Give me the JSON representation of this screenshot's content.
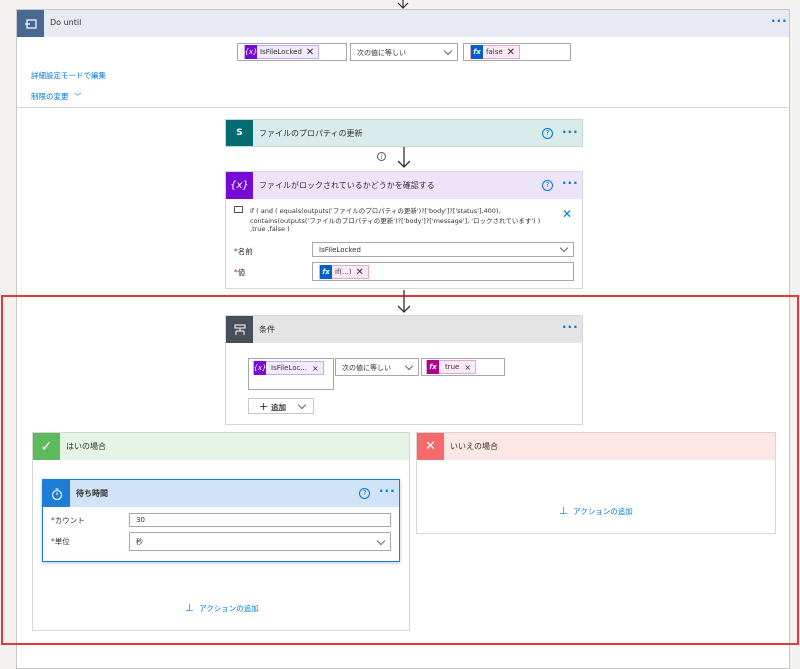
{
  "do_until": {
    "title": "Do until",
    "condition_left": "IsFileLocked",
    "condition_op": "次の値に等しい",
    "condition_right": "false",
    "advanced_link": "詳細設定モードで編集",
    "limits_link": "制限の変更"
  },
  "update_props": {
    "title": "ファイルのプロパティの更新"
  },
  "check_lock": {
    "title": "ファイルがロックされているかどうかを確認する",
    "expression_line1": "if ( and ( equals(outputs('ファイルのプロパティの更新')?['body']?['status'],400),",
    "expression_line2": "contains(outputs('ファイルのプロパティの更新')?['body']?['message'], 'ロックされています') )",
    "expression_line3": ",true ,false )",
    "name_label": "名前",
    "name_value": "IsFileLocked",
    "value_label": "値",
    "value_token": "if(...)"
  },
  "condition": {
    "title": "条件",
    "left_token": "IsFileLoc...",
    "op": "次の値に等しい",
    "right_token": "true",
    "add_label": "追加"
  },
  "yes_branch": {
    "title": "はいの場合",
    "add_action": "アクションの追加"
  },
  "no_branch": {
    "title": "いいえの場合",
    "add_action": "アクションの追加"
  },
  "wait": {
    "title": "待ち時間",
    "count_label": "カウント",
    "count_value": "30",
    "unit_label": "単位",
    "unit_value": "秒"
  },
  "colors": {
    "accent": "#0078d4",
    "do_until_header": "#e7eaf2",
    "variable_purple": "#770bd6",
    "expression_pink": "#ad008c",
    "sharepoint_teal": "#036c70",
    "condition_gray": "#484f58",
    "yes_green": "#5dba5d",
    "no_red": "#f56b6b",
    "highlight_red": "#e03b3b"
  }
}
